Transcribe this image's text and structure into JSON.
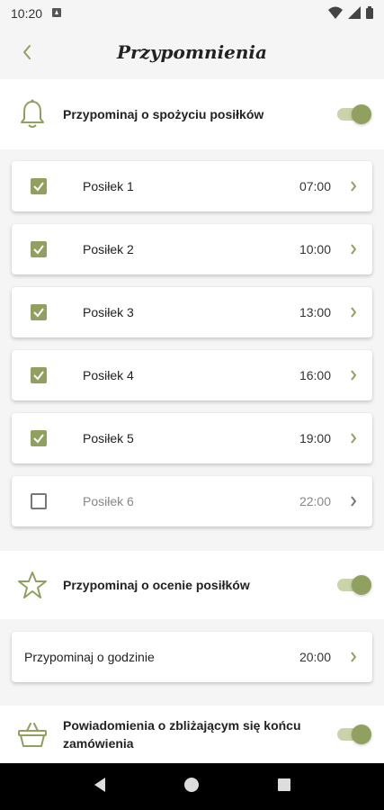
{
  "status_bar": {
    "time": "10:20"
  },
  "header": {
    "title": "Przypomnienia"
  },
  "meals_section": {
    "label": "Przypominaj o spożyciu posiłków",
    "enabled": true
  },
  "meals": [
    {
      "name": "Posiłek 1",
      "time": "07:00",
      "checked": true
    },
    {
      "name": "Posiłek 2",
      "time": "10:00",
      "checked": true
    },
    {
      "name": "Posiłek 3",
      "time": "13:00",
      "checked": true
    },
    {
      "name": "Posiłek 4",
      "time": "16:00",
      "checked": true
    },
    {
      "name": "Posiłek 5",
      "time": "19:00",
      "checked": true
    },
    {
      "name": "Posiłek 6",
      "time": "22:00",
      "checked": false
    }
  ],
  "rating_section": {
    "label": "Przypominaj o ocenie posiłków",
    "enabled": true
  },
  "rating_reminder": {
    "label": "Przypominaj o godzinie",
    "time": "20:00"
  },
  "order_section": {
    "label": "Powiadomienia o zbliżającym się końcu zamówienia",
    "enabled": true
  },
  "colors": {
    "accent": "#8fa05f",
    "accent_light": "#c9d4a8",
    "background": "#f5f5f5"
  }
}
